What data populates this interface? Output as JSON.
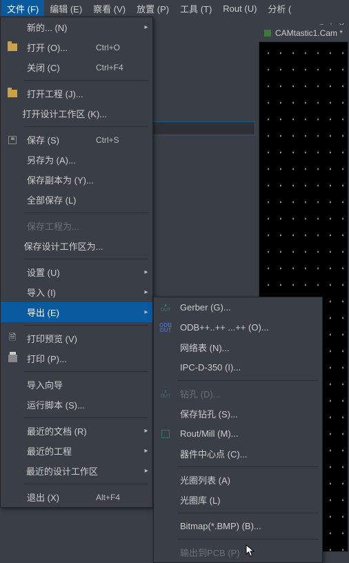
{
  "menubar": {
    "items": [
      {
        "label": "文件 (F)",
        "active": true
      },
      {
        "label": "编辑 (E)"
      },
      {
        "label": "察看 (V)"
      },
      {
        "label": "放置 (P)"
      },
      {
        "label": "工具 (T)"
      },
      {
        "label": "Rout (U)"
      },
      {
        "label": "分析 ("
      }
    ]
  },
  "doc_tab": {
    "label": "CAMtastic1.Cam *"
  },
  "tab_right": {
    "dropdown": "▾",
    "pin": "⊥",
    "close": "✕"
  },
  "file_menu": {
    "new": "新的... (N)",
    "open": "打开 (O)...",
    "open_accel": "Ctrl+O",
    "close": "关闭 (C)",
    "close_accel": "Ctrl+F4",
    "open_proj": "打开工程 (J)...",
    "open_ws": "打开设计工作区 (K)...",
    "save": "保存 (S)",
    "save_accel": "Ctrl+S",
    "save_as": "另存为 (A)...",
    "save_copy": "保存副本为 (Y)...",
    "save_all": "全部保存 (L)",
    "save_proj": "保存工程为...",
    "save_ws": "保存设计工作区为...",
    "setup": "设置 (U)",
    "import": "导入 (I)",
    "export": "导出 (E)",
    "print_prev": "打印预览 (V)",
    "print": "打印 (P)...",
    "import_wiz": "导入向导",
    "run_script": "运行脚本 (S)...",
    "recent_doc": "最近的文档 (R)",
    "recent_proj": "最近的工程",
    "recent_ws": "最近的设计工作区",
    "exit": "退出 (X)",
    "exit_accel": "Alt+F4"
  },
  "export_menu": {
    "gerber": "Gerber (G)...",
    "odb": "ODB++..++ ...++ (O)...",
    "netlist": "网络表 (N)...",
    "ipc": "IPC-D-350 (I)...",
    "drill": "钻孔 (D)...",
    "save_drill": "保存钻孔 (S)...",
    "rout": "Rout/Mill (M)...",
    "centroid": "器件中心点 (C)...",
    "ap_list": "光圈列表 (A)",
    "ap_lib": "光圈库 (L)",
    "bitmap": "Bitmap(*.BMP) (B)...",
    "pcb": "输出到PCB (P)"
  }
}
